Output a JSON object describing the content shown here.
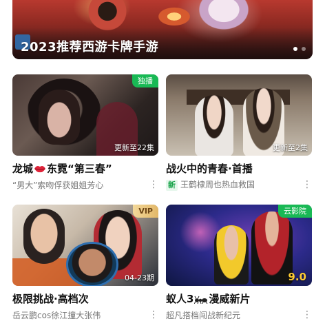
{
  "banner": {
    "title": "2023推荐西游卡牌手游",
    "dots": 2,
    "active_dot": 0
  },
  "cards": [
    {
      "title_prefix": "龙城",
      "title_icon": "lips-icon",
      "title_suffix": "东霓“第三春”",
      "subtitle": "“男大”索吻俘获姐姐芳心",
      "tag": "独播",
      "progress": "更新至22集"
    },
    {
      "title": "战火中的青春·首播",
      "new_label": "新",
      "subtitle": "王鹤棣周也热血救国",
      "progress": "更新至2集"
    },
    {
      "title": "极限挑战·高档次",
      "subtitle": "岳云鹏cos徐江撞大张伟",
      "tag": "VIP",
      "progress": "04-23期"
    },
    {
      "title_prefix": "蚁人3",
      "title_icon": "ant-icon",
      "title_suffix": "漫威新片",
      "subtitle": "超凡搭档闯战新纪元",
      "tag": "云影院",
      "score": "9.0"
    }
  ],
  "colors": {
    "accent_green": "#19b955",
    "vip_gold": "#e2b768",
    "score_yellow": "#ffcc33"
  }
}
